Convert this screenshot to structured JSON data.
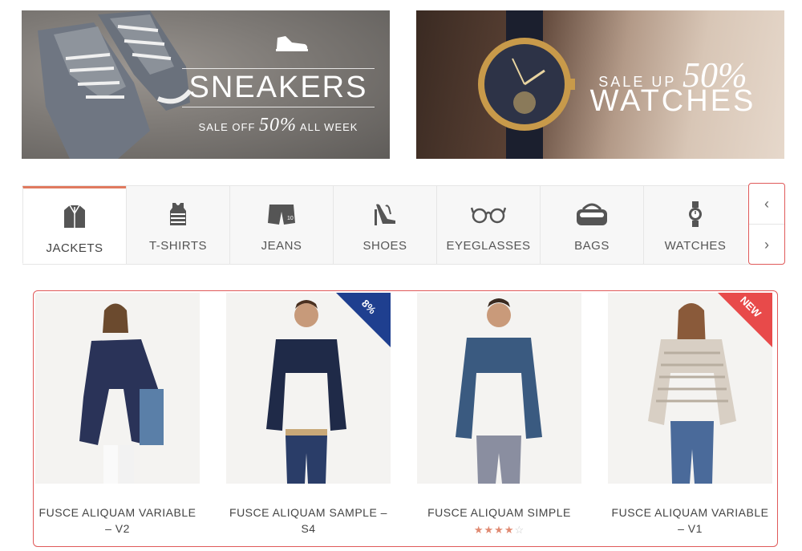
{
  "banners": {
    "sneakers": {
      "icon": "sneaker-icon",
      "title": "SNEAKERS",
      "subtitle_before": "SALE OFF",
      "subtitle_big": "50%",
      "subtitle_after": "ALL WEEK"
    },
    "watches": {
      "line1_prefix": "SALE UP",
      "line1_big": "50%",
      "line2": "WATCHES"
    }
  },
  "tabs": [
    {
      "label": "JACKETS",
      "icon": "jacket-icon",
      "active": true
    },
    {
      "label": "T-SHIRTS",
      "icon": "tank-top-icon",
      "active": false
    },
    {
      "label": "JEANS",
      "icon": "shorts-icon",
      "active": false
    },
    {
      "label": "SHOES",
      "icon": "heels-icon",
      "active": false
    },
    {
      "label": "EYEGLASSES",
      "icon": "glasses-icon",
      "active": false
    },
    {
      "label": "BAGS",
      "icon": "bag-icon",
      "active": false
    },
    {
      "label": "WATCHES",
      "icon": "watch-icon",
      "active": false
    }
  ],
  "tab_nav": {
    "prev": "‹",
    "next": "›"
  },
  "products": [
    {
      "name": "FUSCE ALIQUAM VARIABLE – V2",
      "badge": null
    },
    {
      "name": "FUSCE ALIQUAM SAMPLE – S4",
      "badge": "8%"
    },
    {
      "name": "FUSCE ALIQUAM SIMPLE",
      "badge": null,
      "rating": 4,
      "rating_max": 5
    },
    {
      "name": "FUSCE ALIQUAM VARIABLE – V1",
      "badge": "NEW"
    }
  ],
  "colors": {
    "accent": "#e07a5f",
    "badge_blue": "#1f3f8f",
    "badge_red": "#e84a4a",
    "highlight_border": "#e05a5a"
  }
}
